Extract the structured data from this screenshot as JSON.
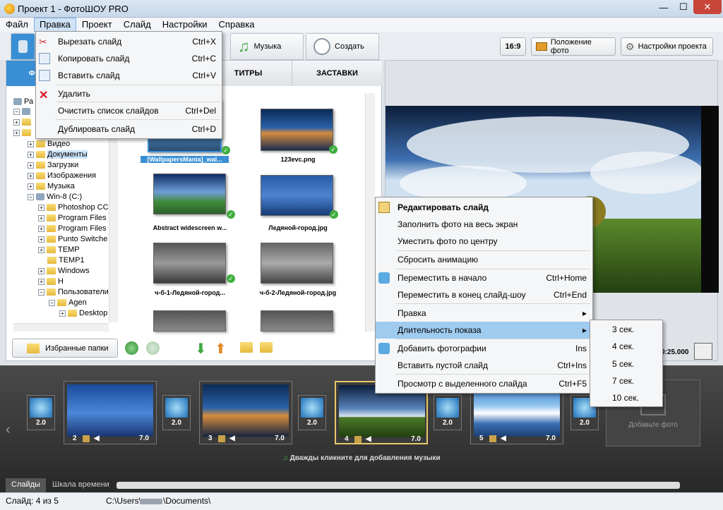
{
  "window": {
    "title": "Проект 1 - ФотоШОУ PRO"
  },
  "menubar": [
    "Файл",
    "Правка",
    "Проект",
    "Слайд",
    "Настройки",
    "Справка"
  ],
  "toolbar": {
    "music_tab": "Музыка",
    "create_tab": "Создать",
    "aspect": "16:9",
    "photo_position": "Положение фото",
    "project_settings": "Настройки проекта"
  },
  "left_panel": {
    "tabs": {
      "photos": "ФО",
      "titles": "ТИТРЫ",
      "screensavers": "ЗАСТАВКИ"
    },
    "tree": [
      {
        "label": "Ра",
        "level": 0
      },
      {
        "label": "Видео",
        "level": 1
      },
      {
        "label": "Документы",
        "level": 1
      },
      {
        "label": "Загрузки",
        "level": 1
      },
      {
        "label": "Изображения",
        "level": 1
      },
      {
        "label": "Музыка",
        "level": 1
      },
      {
        "label": "Win-8 (C:)",
        "level": 1
      },
      {
        "label": "Photoshop CC",
        "level": 2
      },
      {
        "label": "Program Files",
        "level": 2
      },
      {
        "label": "Program Files",
        "level": 2
      },
      {
        "label": "Punto Switche",
        "level": 2
      },
      {
        "label": "TEMP",
        "level": 2
      },
      {
        "label": "TEMP1",
        "level": 2
      },
      {
        "label": "Windows",
        "level": 2
      },
      {
        "label": "H",
        "level": 2
      },
      {
        "label": "Пользователи",
        "level": 2
      },
      {
        "label": "Agen",
        "level": 3
      },
      {
        "label": "Desktop",
        "level": 4
      }
    ],
    "thumbnails": [
      {
        "caption": "[WallpapersMania]_wal..."
      },
      {
        "caption": "123evc.png"
      },
      {
        "caption": "Abstract widescreen w..."
      },
      {
        "caption": "Ледяной-город.jpg"
      },
      {
        "caption": "ч-б-1-Ледяной-город..."
      },
      {
        "caption": "ч-б-2-Ледяной-город.jpg"
      }
    ],
    "favorites_button": "Избранные папки"
  },
  "preview": {
    "time": "0:25.000"
  },
  "edit_menu": [
    {
      "label": "Вырезать слайд",
      "shortcut": "Ctrl+X"
    },
    {
      "label": "Копировать слайд",
      "shortcut": "Ctrl+C"
    },
    {
      "label": "Вставить слайд",
      "shortcut": "Ctrl+V"
    },
    {
      "label": "Удалить",
      "shortcut": ""
    },
    {
      "label": "Очистить список слайдов",
      "shortcut": "Ctrl+Del"
    },
    {
      "label": "Дублировать слайд",
      "shortcut": "Ctrl+D"
    }
  ],
  "context_menu": [
    {
      "label": "Редактировать слайд",
      "shortcut": ""
    },
    {
      "label": "Заполнить фото на весь экран",
      "shortcut": ""
    },
    {
      "label": "Уместить фото по центру",
      "shortcut": ""
    },
    {
      "label": "Сбросить анимацию",
      "shortcut": ""
    },
    {
      "label": "Переместить в начало",
      "shortcut": "Ctrl+Home"
    },
    {
      "label": "Переместить в конец слайд-шоу",
      "shortcut": "Ctrl+End"
    },
    {
      "label": "Правка",
      "shortcut": "▸"
    },
    {
      "label": "Длительность показа",
      "shortcut": "▸"
    },
    {
      "label": "Добавить фотографии",
      "shortcut": "Ins"
    },
    {
      "label": "Вставить пустой слайд",
      "shortcut": "Ctrl+Ins"
    },
    {
      "label": "Просмотр с выделенного слайда",
      "shortcut": "Ctrl+F5"
    }
  ],
  "duration_submenu": [
    "3 сек.",
    "4 сек.",
    "5 сек.",
    "7 сек.",
    "10 сек."
  ],
  "filmstrip": {
    "slides": [
      {
        "num": "2",
        "dur": "7.0"
      },
      {
        "num": "3",
        "dur": "7.0"
      },
      {
        "num": "4",
        "dur": "7.0"
      },
      {
        "num": "5",
        "dur": "7.0"
      }
    ],
    "transitions": [
      "2.0",
      "2.0",
      "2.0",
      "2.0",
      "2.0"
    ],
    "add_photo": "Добавьте фото",
    "music_hint": "Дважды кликните для добавления музыки"
  },
  "bottom_tabs": {
    "slides": "Слайды",
    "timeline": "Шкала времени"
  },
  "status": {
    "slide_info": "Слайд: 4 из 5",
    "path_start": "C:\\Users\\",
    "path_end": "\\Documents\\"
  }
}
